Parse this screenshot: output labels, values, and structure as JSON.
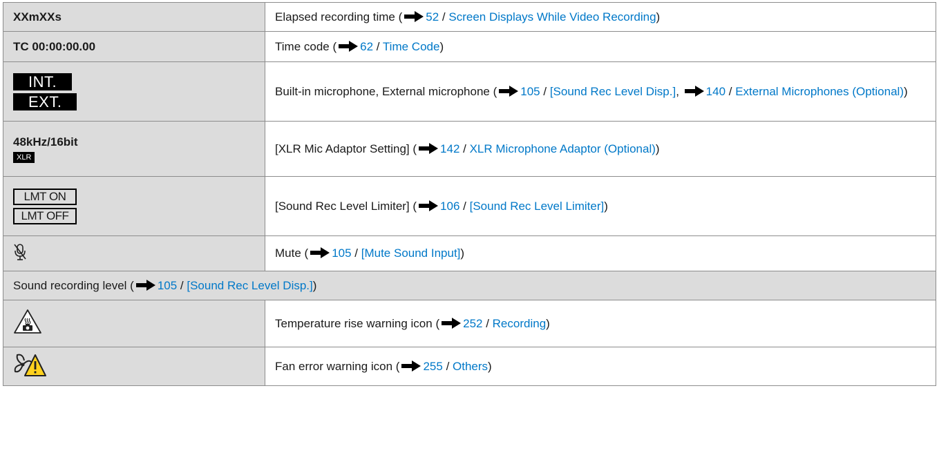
{
  "rows": [
    {
      "left_text": "XXmXXs",
      "desc": "Elapsed recording time (",
      "page": "52",
      "sep": " / ",
      "link": "Screen Displays While Video Recording",
      "tail": ")"
    },
    {
      "left_text": "TC 00:00:00.00",
      "desc": "Time code (",
      "page": "62",
      "sep": " / ",
      "link": "Time Code",
      "tail": ")"
    },
    {
      "badges": [
        "INT.",
        "EXT."
      ],
      "desc": "Built-in microphone, External microphone (",
      "page": "105",
      "sep": " / ",
      "link": "[Sound Rec Level Disp.]",
      "mid": ", ",
      "page2": "140",
      "sep2": " / ",
      "link2": "External Microphones (Optional)",
      "tail": ")"
    },
    {
      "left_text": "48kHz/16bit",
      "xlr": "XLR",
      "desc": "[XLR Mic Adaptor Setting] (",
      "page": "142",
      "sep": " / ",
      "link": "XLR Microphone Adaptor (Optional)",
      "tail": ")"
    },
    {
      "lmt": [
        "LMT ON",
        "LMT OFF"
      ],
      "desc": "[Sound Rec Level Limiter] (",
      "page": "106",
      "sep": " / ",
      "link": "[Sound Rec Level Limiter]",
      "tail": ")"
    },
    {
      "icon": "mic-mute-icon",
      "desc": "Mute (",
      "page": "105",
      "sep": " / ",
      "link": "[Mute Sound Input]",
      "tail": ")"
    },
    {
      "full": true,
      "desc": "Sound recording level (",
      "page": "105",
      "sep": " / ",
      "link": "[Sound Rec Level Disp.]",
      "tail": ")"
    },
    {
      "icon": "temperature-warning-icon",
      "desc": "Temperature rise warning icon (",
      "page": "252",
      "sep": " / ",
      "link": "Recording",
      "tail": ")"
    },
    {
      "icon": "fan-error-warning-icon",
      "desc": "Fan error warning icon (",
      "page": "255",
      "sep": " / ",
      "link": "Others",
      "tail": ")"
    }
  ],
  "colors": {
    "link": "#0078c8",
    "left_bg": "#dcdcdc",
    "border": "#8c8c8c"
  }
}
